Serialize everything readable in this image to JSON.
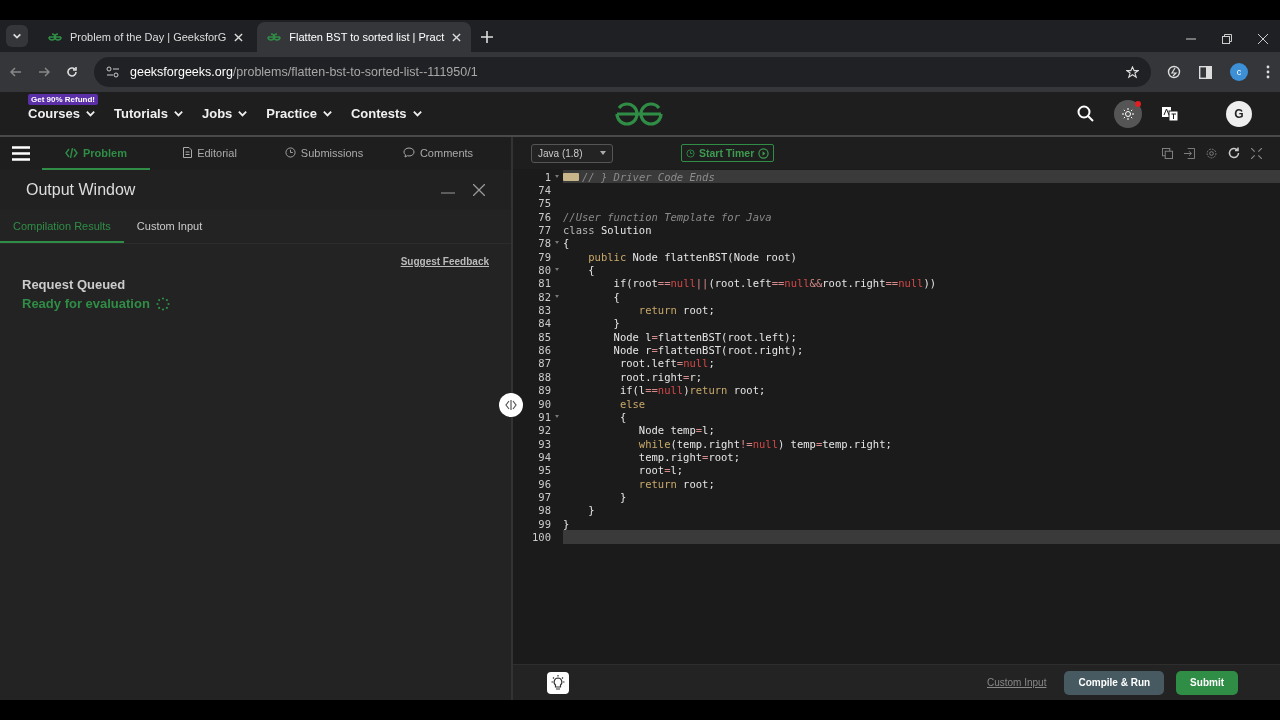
{
  "browser": {
    "tabs": [
      {
        "title": "Problem of the Day | GeeksforG",
        "selected": false
      },
      {
        "title": "Flatten BST to sorted list | Pract",
        "selected": true
      }
    ],
    "address": {
      "host": "geeksforgeeks.org",
      "path": "/problems/flatten-bst-to-sorted-list--111950/1"
    },
    "profile": "c"
  },
  "site_nav": {
    "badge": "Get 90% Refund!",
    "items": [
      "Courses",
      "Tutorials",
      "Jobs",
      "Practice",
      "Contests"
    ],
    "avatar": "G"
  },
  "problem_tabs": [
    {
      "label": "Problem",
      "selected": true
    },
    {
      "label": "Editorial",
      "selected": false
    },
    {
      "label": "Submissions",
      "selected": false
    },
    {
      "label": "Comments",
      "selected": false
    }
  ],
  "output_window": {
    "title": "Output Window",
    "tabs": [
      {
        "label": "Compilation Results",
        "selected": true
      },
      {
        "label": "Custom Input",
        "selected": false
      }
    ],
    "feedback_link": "Suggest Feedback",
    "status": "Request Queued",
    "message": "Ready for evaluation"
  },
  "editor": {
    "language": "Java (1.8)",
    "timer": "Start Timer",
    "lines": [
      {
        "num": "1",
        "highlighted": true,
        "foldable": true,
        "folded": true,
        "tokens": [
          {
            "text": "// } Driver Code Ends",
            "kind": "faded"
          }
        ]
      },
      {
        "num": "74",
        "highlighted": false,
        "foldable": false
      },
      {
        "num": "75",
        "highlighted": false,
        "foldable": false
      },
      {
        "num": "76",
        "highlighted": false,
        "foldable": false,
        "tokens": [
          {
            "text": "//User function Template for Java",
            "kind": "comment"
          }
        ]
      },
      {
        "num": "77",
        "highlighted": false,
        "foldable": false,
        "tokens": [
          {
            "text": "class",
            "kind": "cls"
          },
          {
            "text": " Solution",
            "kind": "text"
          }
        ]
      },
      {
        "num": "78",
        "highlighted": false,
        "foldable": true,
        "tokens": [
          {
            "text": "{",
            "kind": "text"
          }
        ]
      },
      {
        "num": "79",
        "highlighted": false,
        "foldable": false,
        "tokens": [
          {
            "text": "    public",
            "kind": "keyword"
          },
          {
            "text": " Node flattenBST(Node root)",
            "kind": "text"
          }
        ]
      },
      {
        "num": "80",
        "highlighted": false,
        "foldable": true,
        "tokens": [
          {
            "text": "    {",
            "kind": "text"
          }
        ]
      },
      {
        "num": "81",
        "highlighted": false,
        "foldable": false,
        "tokens": [
          {
            "text": "        if(root",
            "kind": "text"
          },
          {
            "text": "==",
            "kind": "operator"
          },
          {
            "text": "null",
            "kind": "null"
          },
          {
            "text": "||",
            "kind": "operator"
          },
          {
            "text": "(root.left",
            "kind": "text"
          },
          {
            "text": "==",
            "kind": "operator"
          },
          {
            "text": "null",
            "kind": "null"
          },
          {
            "text": "&&",
            "kind": "operator"
          },
          {
            "text": "root.right",
            "kind": "text"
          },
          {
            "text": "==",
            "kind": "operator"
          },
          {
            "text": "null",
            "kind": "null"
          },
          {
            "text": "))",
            "kind": "text"
          }
        ]
      },
      {
        "num": "82",
        "highlighted": false,
        "foldable": true,
        "tokens": [
          {
            "text": "        {",
            "kind": "text"
          }
        ]
      },
      {
        "num": "83",
        "highlighted": false,
        "foldable": false,
        "tokens": [
          {
            "text": "            return",
            "kind": "keyword"
          },
          {
            "text": " root;",
            "kind": "text"
          }
        ]
      },
      {
        "num": "84",
        "highlighted": false,
        "foldable": false,
        "tokens": [
          {
            "text": "        }",
            "kind": "text"
          }
        ]
      },
      {
        "num": "85",
        "highlighted": false,
        "foldable": false,
        "tokens": [
          {
            "text": "        Node l",
            "kind": "text"
          },
          {
            "text": "=",
            "kind": "operator"
          },
          {
            "text": "flattenBST(root.left);",
            "kind": "text"
          }
        ]
      },
      {
        "num": "86",
        "highlighted": false,
        "foldable": false,
        "tokens": [
          {
            "text": "        Node r",
            "kind": "text"
          },
          {
            "text": "=",
            "kind": "operator"
          },
          {
            "text": "flattenBST(root.right);",
            "kind": "text"
          }
        ]
      },
      {
        "num": "87",
        "highlighted": false,
        "foldable": false,
        "tokens": [
          {
            "text": "         root.left",
            "kind": "text"
          },
          {
            "text": "=",
            "kind": "operator"
          },
          {
            "text": "null",
            "kind": "null"
          },
          {
            "text": ";",
            "kind": "text"
          }
        ]
      },
      {
        "num": "88",
        "highlighted": false,
        "foldable": false,
        "tokens": [
          {
            "text": "         root.right",
            "kind": "text"
          },
          {
            "text": "=",
            "kind": "operator"
          },
          {
            "text": "r;",
            "kind": "text"
          }
        ]
      },
      {
        "num": "89",
        "highlighted": false,
        "foldable": false,
        "tokens": [
          {
            "text": "         if(l",
            "kind": "text"
          },
          {
            "text": "==",
            "kind": "operator"
          },
          {
            "text": "null",
            "kind": "null"
          },
          {
            "text": ")",
            "kind": "text"
          },
          {
            "text": "return",
            "kind": "keyword"
          },
          {
            "text": " root;",
            "kind": "text"
          }
        ]
      },
      {
        "num": "90",
        "highlighted": false,
        "foldable": false,
        "tokens": [
          {
            "text": "         else",
            "kind": "keyword"
          }
        ]
      },
      {
        "num": "91",
        "highlighted": false,
        "foldable": true,
        "tokens": [
          {
            "text": "         {",
            "kind": "text"
          }
        ]
      },
      {
        "num": "92",
        "highlighted": false,
        "foldable": false,
        "tokens": [
          {
            "text": "            Node temp",
            "kind": "text"
          },
          {
            "text": "=",
            "kind": "operator"
          },
          {
            "text": "l;",
            "kind": "text"
          }
        ]
      },
      {
        "num": "93",
        "highlighted": false,
        "foldable": false,
        "tokens": [
          {
            "text": "            while",
            "kind": "keyword"
          },
          {
            "text": "(temp.right",
            "kind": "text"
          },
          {
            "text": "!=",
            "kind": "operator"
          },
          {
            "text": "null",
            "kind": "null"
          },
          {
            "text": ") temp",
            "kind": "text"
          },
          {
            "text": "=",
            "kind": "operator"
          },
          {
            "text": "temp.right;",
            "kind": "text"
          }
        ]
      },
      {
        "num": "94",
        "highlighted": false,
        "foldable": false,
        "tokens": [
          {
            "text": "            temp.right",
            "kind": "text"
          },
          {
            "text": "=",
            "kind": "operator"
          },
          {
            "text": "root;",
            "kind": "text"
          }
        ]
      },
      {
        "num": "95",
        "highlighted": false,
        "foldable": false,
        "tokens": [
          {
            "text": "            root",
            "kind": "text"
          },
          {
            "text": "=",
            "kind": "operator"
          },
          {
            "text": "l;",
            "kind": "text"
          }
        ]
      },
      {
        "num": "96",
        "highlighted": false,
        "foldable": false,
        "tokens": [
          {
            "text": "            return",
            "kind": "keyword"
          },
          {
            "text": " root;",
            "kind": "text"
          }
        ]
      },
      {
        "num": "97",
        "highlighted": false,
        "foldable": false,
        "tokens": [
          {
            "text": "         }",
            "kind": "text"
          }
        ]
      },
      {
        "num": "98",
        "highlighted": false,
        "foldable": false,
        "tokens": [
          {
            "text": "    }",
            "kind": "text"
          }
        ]
      },
      {
        "num": "99",
        "highlighted": false,
        "foldable": false,
        "tokens": [
          {
            "text": "}",
            "kind": "text"
          }
        ]
      },
      {
        "num": "100",
        "highlighted": true,
        "foldable": false
      }
    ]
  },
  "footer": {
    "custom_input": "Custom Input",
    "compile": "Compile & Run",
    "submit": "Submit"
  }
}
